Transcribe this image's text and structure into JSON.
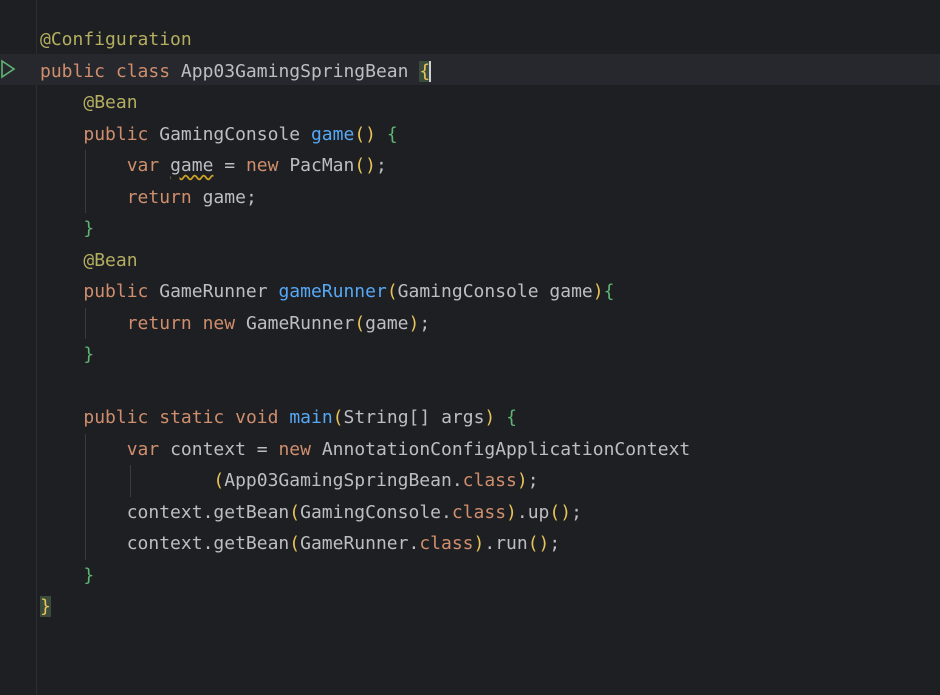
{
  "colors": {
    "background": "#1e1f22",
    "keyword": "#cf8e6d",
    "annotation": "#b3ae60",
    "function": "#56a8f5",
    "identifier": "#bcbec4",
    "bracket_yellow": "#e8c35a",
    "bracket_green": "#5fb573",
    "run_icon": "#5fb573"
  },
  "icons": {
    "run": "run-gutter-icon"
  },
  "code": {
    "l1": {
      "annotation": "@Configuration"
    },
    "l2": {
      "kw_public": "public",
      "kw_class": "class",
      "class_name": "App03GamingSpringBean",
      "open_brace": "{"
    },
    "l3": {
      "annotation": "@Bean"
    },
    "l4": {
      "kw_public": "public",
      "type": "GamingConsole",
      "method": "game",
      "parens": "()",
      "open_brace": "{"
    },
    "l5": {
      "kw_var": "var",
      "var_name": "game",
      "assign": "=",
      "kw_new": "new",
      "ctor": "PacMan",
      "parens": "()",
      "semi": ";"
    },
    "l6": {
      "kw_return": "return",
      "value": "game",
      "semi": ";"
    },
    "l7": {
      "close_brace": "}"
    },
    "l8": {
      "annotation": "@Bean"
    },
    "l9": {
      "kw_public": "public",
      "type": "GameRunner",
      "method": "gameRunner",
      "open_paren": "(",
      "param_type": "GamingConsole",
      "param_name": "game",
      "close_paren": ")",
      "open_brace": "{"
    },
    "l10": {
      "kw_return": "return",
      "kw_new": "new",
      "ctor": "GameRunner",
      "open_paren": "(",
      "arg": "game",
      "close_paren": ")",
      "semi": ";"
    },
    "l11": {
      "close_brace": "}"
    },
    "l13": {
      "kw_public": "public",
      "kw_static": "static",
      "kw_void": "void",
      "method": "main",
      "open_paren": "(",
      "param_type": "String[]",
      "param_name": "args",
      "close_paren": ")",
      "open_brace": "{"
    },
    "l14": {
      "kw_var": "var",
      "var_name": "context",
      "assign": "=",
      "kw_new": "new",
      "ctor": "AnnotationConfigApplicationContext"
    },
    "l15": {
      "open_paren": "(",
      "class_ref": "App03GamingSpringBean",
      "dot": ".",
      "kw_class": "class",
      "close_paren": ")",
      "semi": ";"
    },
    "l16": {
      "receiver": "context",
      "call": ".getBean",
      "open_paren": "(",
      "class_ref": "GamingConsole",
      "dot": ".",
      "kw_class": "class",
      "close_paren": ")",
      "tail": ".up",
      "parens": "()",
      "semi": ";"
    },
    "l17": {
      "receiver": "context",
      "call": ".getBean",
      "open_paren": "(",
      "class_ref": "GameRunner",
      "dot": ".",
      "kw_class": "class",
      "close_paren": ")",
      "tail": ".run",
      "parens": "()",
      "semi": ";"
    },
    "l18": {
      "close_brace": "}"
    },
    "l19": {
      "close_brace": "}"
    }
  }
}
